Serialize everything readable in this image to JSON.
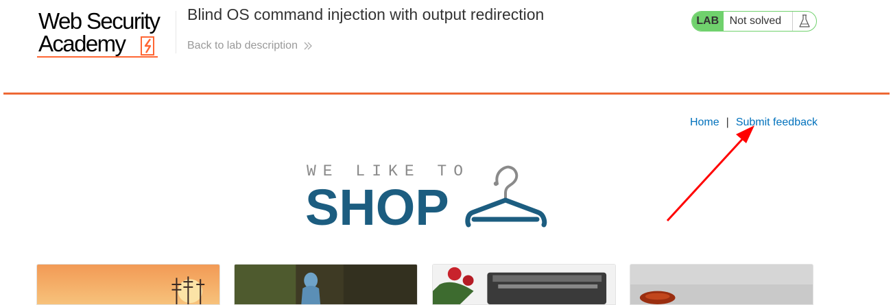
{
  "brand": {
    "line1": "Web Security",
    "line2": "Academy",
    "accent": "#ff6633"
  },
  "lab": {
    "title": "Blind OS command injection with output redirection",
    "back_link": "Back to lab description",
    "status_tag": "LAB",
    "status_text": "Not solved",
    "status_icon": "flask-icon",
    "status_color": "#70d16d"
  },
  "nav": {
    "home": "Home",
    "separator": "|",
    "feedback": "Submit feedback",
    "link_color": "#0071bc"
  },
  "shop_logo": {
    "tagline": "WE LIKE TO",
    "word": "SHOP",
    "icon": "hanger-icon",
    "color": "#1c5d80"
  },
  "products": [
    {
      "image": "sunset-masts-image"
    },
    {
      "image": "blue-statue-image"
    },
    {
      "image": "roses-typewriter-image"
    },
    {
      "image": "grey-object-image"
    }
  ]
}
